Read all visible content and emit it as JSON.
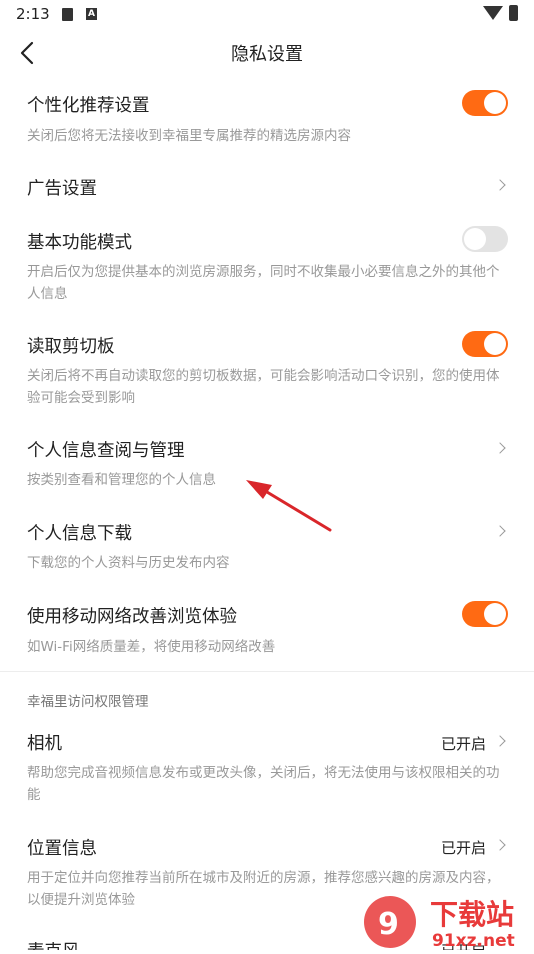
{
  "status_bar": {
    "time": "2:13",
    "icons": [
      "sim-card-icon",
      "a-notification-icon",
      "wifi-icon",
      "battery-icon"
    ]
  },
  "header": {
    "title": "隐私设置",
    "back_icon": "back-arrow-icon"
  },
  "settings": [
    {
      "label": "个性化推荐设置",
      "desc": "关闭后您将无法接收到幸福里专属推荐的精选房源内容",
      "control": "toggle",
      "on": true
    },
    {
      "label": "广告设置",
      "desc": "",
      "control": "chevron"
    },
    {
      "label": "基本功能模式",
      "desc": "开启后仅为您提供基本的浏览房源服务，同时不收集最小必要信息之外的其他个人信息",
      "control": "toggle",
      "on": false
    },
    {
      "label": "读取剪切板",
      "desc": "关闭后将不再自动读取您的剪切板数据，可能会影响活动口令识别，您的使用体验可能会受到影响",
      "control": "toggle",
      "on": true
    },
    {
      "label": "个人信息查阅与管理",
      "desc": "按类别查看和管理您的个人信息",
      "control": "chevron"
    },
    {
      "label": "个人信息下载",
      "desc": "下载您的个人资料与历史发布内容",
      "control": "chevron"
    },
    {
      "label": "使用移动网络改善浏览体验",
      "desc": "如Wi-Fi网络质量差，将使用移动网络改善",
      "control": "toggle",
      "on": true
    }
  ],
  "permissions_section": {
    "title": "幸福里访问权限管理",
    "items": [
      {
        "label": "相机",
        "status": "已开启",
        "desc": "帮助您完成音视频信息发布或更改头像，关闭后，将无法使用与该权限相关的功能"
      },
      {
        "label": "位置信息",
        "status": "已开启",
        "desc": "用于定位并向您推荐当前所在城市及附近的房源，推荐您感兴趣的房源及内容，以便提升浏览体验"
      },
      {
        "label": "麦克风",
        "status": "已开启",
        "desc": ""
      }
    ]
  },
  "watermark": {
    "text": "下载站",
    "url_text": "91xz.net"
  },
  "colors": {
    "accent": "#ff6a13",
    "toggle_off": "#e3e3e3",
    "annotation_arrow": "#d9262a",
    "desc_text": "#999999"
  }
}
